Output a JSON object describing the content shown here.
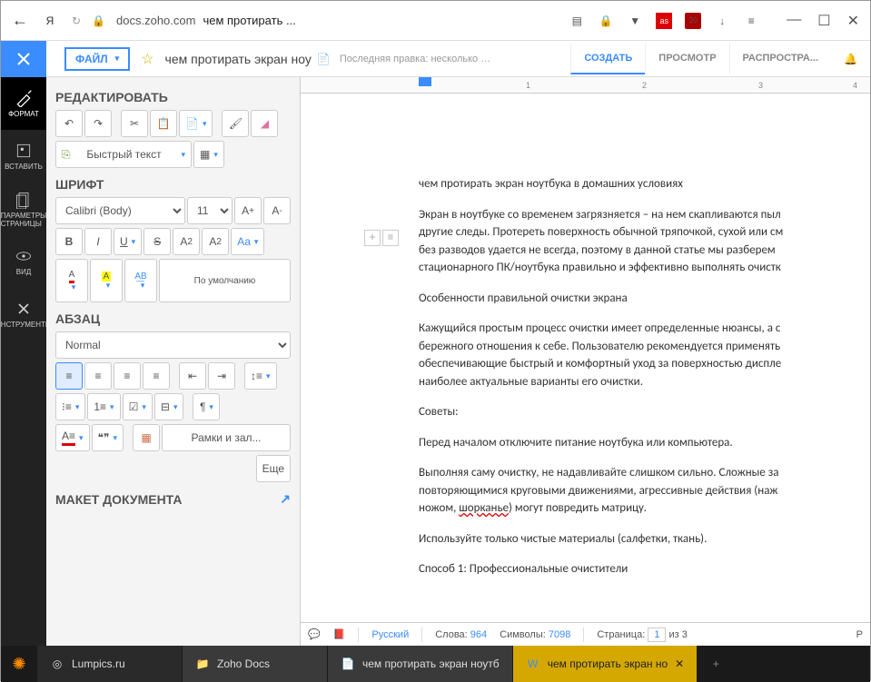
{
  "browser": {
    "logo": "Я",
    "domain": "docs.zoho.com",
    "title": "чем протирать ...",
    "ext_badge": "20"
  },
  "app": {
    "file_label": "ФАЙЛ",
    "doc_title": "чем протирать экран ноу",
    "last_edit": "Последняя правка: несколько секунд ...",
    "tabs": {
      "create": "СОЗДАТЬ",
      "view": "ПРОСМОТР",
      "share": "РАСПРОСТРА..."
    }
  },
  "rail": {
    "format": "ФОРМАТ",
    "insert": "ВСТАВИТЬ",
    "page": "ПАРАМЕТРЫ СТРАНИЦЫ",
    "view": "ВИД",
    "tools": "ИНСТРУМЕНТЫ"
  },
  "toolbox": {
    "edit_title": "РЕДАКТИРОВАТЬ",
    "quick_text": "Быстрый текст",
    "font_title": "ШРИФТ",
    "font_name": "Calibri (Body)",
    "font_size": "11",
    "default_label": "По умолчанию",
    "para_title": "АБЗАЦ",
    "para_style": "Normal",
    "frames_label": "Рамки и зал...",
    "more_label": "Еще",
    "layout_title": "МАКЕТ ДОКУМЕНТА"
  },
  "document": {
    "p1": "чем протирать экран ноутбука в домашних условиях",
    "p2": "Экран в ноутбуке со временем загрязняется – на нем скапливаются пыл",
    "p3": "другие следы. Протереть поверхность обычной тряпочкой, сухой или см",
    "p4": "без разводов удается не всегда, поэтому в данной статье мы разберем",
    "p5": "стационарного ПК/ноутбука правильно и эффективно выполнять очистк",
    "p6": "Особенности правильной очистки экрана",
    "p7": "Кажущийся простым процесс очистки имеет определенные нюансы, а с",
    "p8": "бережного отношения к себе. Пользователю рекомендуется применять",
    "p9": "обеспечивающие быстрый и комфортный уход за поверхностью диспле",
    "p10": "наиболее актуальные варианты его очистки.",
    "p11": "Советы:",
    "p12": "Перед началом отключите питание ноутбука или компьютера.",
    "p13a": "Выполняя саму очистку, не надавливайте слишком сильно. Сложные за",
    "p13b": "повторяющимися круговыми движениями, агрессивные действия (наж",
    "p13c_pre": "ножом, ",
    "p13c_err": "шорканье",
    "p13c_post": ") могут повредить матрицу.",
    "p14": "Используйте только чистые материалы (салфетки, ткань).",
    "p15": "Способ 1: Профессиональные очистители"
  },
  "status": {
    "lang": "Русский",
    "words_lbl": "Слова:",
    "words": "964",
    "chars_lbl": "Символы:",
    "chars": "7098",
    "page_lbl": "Страница:",
    "page": "1",
    "of": "из 3"
  },
  "taskbar": {
    "t1": "Lumpics.ru",
    "t2": "Zoho Docs",
    "t3": "чем протирать экран ноутб",
    "t4": "чем протирать экран но"
  },
  "ruler": {
    "m1": "1",
    "m2": "2",
    "m3": "3",
    "m4": "4"
  }
}
